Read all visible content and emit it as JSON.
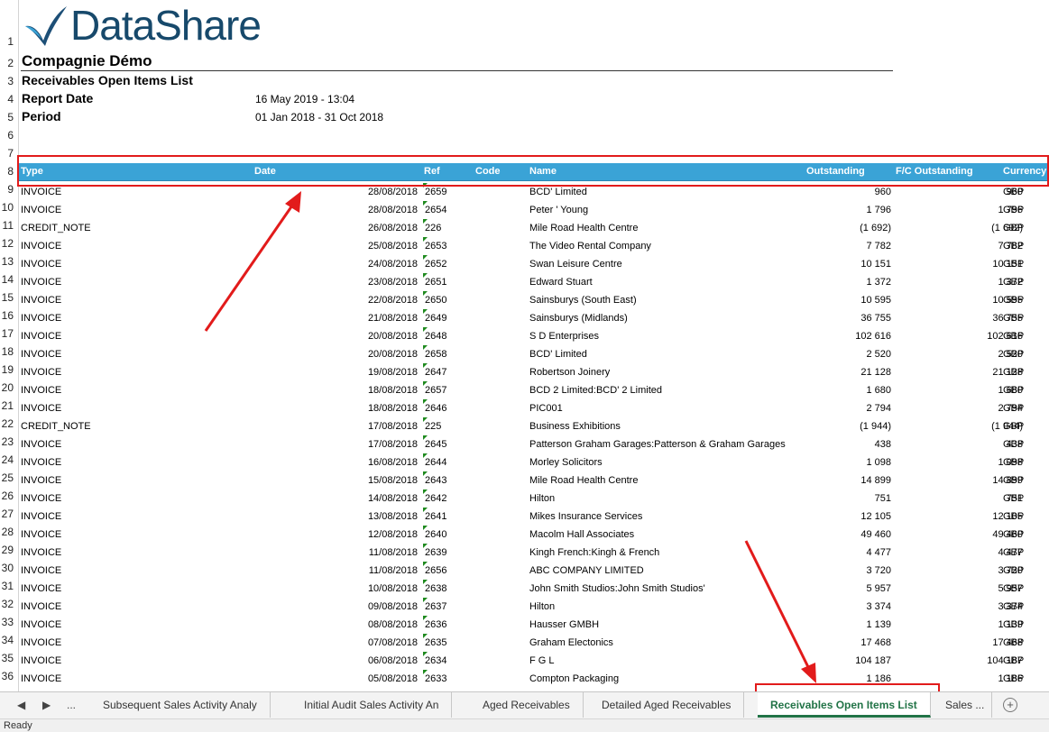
{
  "logo": {
    "text": "DataShare",
    "brand_color": "#17496b"
  },
  "company": "Compagnie Démo",
  "report_title": "Receivables Open Items List",
  "report_date": {
    "label": "Report Date",
    "value": "16 May 2019 - 13:04"
  },
  "period": {
    "label": "Period",
    "value": "01 Jan 2018 - 31 Oct 2018"
  },
  "row_numbers": [
    "1",
    "2",
    "3",
    "4",
    "5",
    "6",
    "7",
    "8",
    "9",
    "10",
    "11",
    "12",
    "13",
    "14",
    "15",
    "16",
    "17",
    "18",
    "19",
    "20",
    "21",
    "22",
    "23",
    "24",
    "25",
    "26",
    "27",
    "28",
    "29",
    "30",
    "31",
    "32",
    "33",
    "34",
    "35",
    "36"
  ],
  "columns": {
    "type": "Type",
    "date": "Date",
    "ref": "Ref",
    "code": "Code",
    "name": "Name",
    "outstanding": "Outstanding",
    "fc_outstanding": "F/C Outstanding",
    "currency": "Currency"
  },
  "rows": [
    {
      "type": "INVOICE",
      "date": "28/08/2018",
      "ref": "2659",
      "name": "BCD' Limited",
      "out": "960",
      "fc": "960",
      "cur": "GBP"
    },
    {
      "type": "INVOICE",
      "date": "28/08/2018",
      "ref": "2654",
      "name": "Peter ' Young",
      "out": "1 796",
      "fc": "1 796",
      "cur": "GBP"
    },
    {
      "type": "CREDIT_NOTE",
      "date": "26/08/2018",
      "ref": "226",
      "name": "Mile Road Health Centre",
      "out": "(1 692)",
      "fc": "(1 692)",
      "cur": "GBP"
    },
    {
      "type": "INVOICE",
      "date": "25/08/2018",
      "ref": "2653",
      "name": "The Video Rental Company",
      "out": "7 782",
      "fc": "7 782",
      "cur": "GBP"
    },
    {
      "type": "INVOICE",
      "date": "24/08/2018",
      "ref": "2652",
      "name": "Swan Leisure Centre",
      "out": "10 151",
      "fc": "10 151",
      "cur": "GBP"
    },
    {
      "type": "INVOICE",
      "date": "23/08/2018",
      "ref": "2651",
      "name": "Edward Stuart",
      "out": "1 372",
      "fc": "1 372",
      "cur": "GBP"
    },
    {
      "type": "INVOICE",
      "date": "22/08/2018",
      "ref": "2650",
      "name": "Sainsburys (South East)",
      "out": "10 595",
      "fc": "10 595",
      "cur": "GBP"
    },
    {
      "type": "INVOICE",
      "date": "21/08/2018",
      "ref": "2649",
      "name": "Sainsburys (Midlands)",
      "out": "36 755",
      "fc": "36 755",
      "cur": "GBP"
    },
    {
      "type": "INVOICE",
      "date": "20/08/2018",
      "ref": "2648",
      "name": "S D Enterprises",
      "out": "102 616",
      "fc": "102 616",
      "cur": "GBP"
    },
    {
      "type": "INVOICE",
      "date": "20/08/2018",
      "ref": "2658",
      "name": "BCD' Limited",
      "out": "2 520",
      "fc": "2 520",
      "cur": "GBP"
    },
    {
      "type": "INVOICE",
      "date": "19/08/2018",
      "ref": "2647",
      "name": "Robertson Joinery",
      "out": "21 128",
      "fc": "21 128",
      "cur": "GBP"
    },
    {
      "type": "INVOICE",
      "date": "18/08/2018",
      "ref": "2657",
      "name": "BCD  2 Limited:BCD' 2 Limited",
      "out": "1 680",
      "fc": "1 680",
      "cur": "GBP"
    },
    {
      "type": "INVOICE",
      "date": "18/08/2018",
      "ref": "2646",
      "name": "PIC001",
      "out": "2 794",
      "fc": "2 794",
      "cur": "GBP"
    },
    {
      "type": "CREDIT_NOTE",
      "date": "17/08/2018",
      "ref": "225",
      "name": "Business Exhibitions",
      "out": "(1 944)",
      "fc": "(1 944)",
      "cur": "GBP"
    },
    {
      "type": "INVOICE",
      "date": "17/08/2018",
      "ref": "2645",
      "name": "Patterson   Graham Garages:Patterson & Graham Garages",
      "out": "438",
      "fc": "438",
      "cur": "GBP"
    },
    {
      "type": "INVOICE",
      "date": "16/08/2018",
      "ref": "2644",
      "name": "Morley Solicitors",
      "out": "1 098",
      "fc": "1 098",
      "cur": "GBP"
    },
    {
      "type": "INVOICE",
      "date": "15/08/2018",
      "ref": "2643",
      "name": "Mile Road Health Centre",
      "out": "14 899",
      "fc": "14 899",
      "cur": "GBP"
    },
    {
      "type": "INVOICE",
      "date": "14/08/2018",
      "ref": "2642",
      "name": "Hilton",
      "out": "751",
      "fc": "751",
      "cur": "GBP"
    },
    {
      "type": "INVOICE",
      "date": "13/08/2018",
      "ref": "2641",
      "name": "Mikes Insurance Services",
      "out": "12 105",
      "fc": "12 105",
      "cur": "GBP"
    },
    {
      "type": "INVOICE",
      "date": "12/08/2018",
      "ref": "2640",
      "name": "Macolm Hall Associates",
      "out": "49 460",
      "fc": "49 460",
      "cur": "GBP"
    },
    {
      "type": "INVOICE",
      "date": "11/08/2018",
      "ref": "2639",
      "name": "Kingh   French:Kingh & French",
      "out": "4 477",
      "fc": "4 477",
      "cur": "GBP"
    },
    {
      "type": "INVOICE",
      "date": "11/08/2018",
      "ref": "2656",
      "name": "ABC COMPANY LIMITED",
      "out": "3 720",
      "fc": "3 720",
      "cur": "GBP"
    },
    {
      "type": "INVOICE",
      "date": "10/08/2018",
      "ref": "2638",
      "name": "John Smith Studios:John Smith Studios'",
      "out": "5 957",
      "fc": "5 957",
      "cur": "GBP"
    },
    {
      "type": "INVOICE",
      "date": "09/08/2018",
      "ref": "2637",
      "name": "Hilton",
      "out": "3 374",
      "fc": "3 374",
      "cur": "GBP"
    },
    {
      "type": "INVOICE",
      "date": "08/08/2018",
      "ref": "2636",
      "name": "Hausser GMBH",
      "out": "1 139",
      "fc": "1 139",
      "cur": "GBP"
    },
    {
      "type": "INVOICE",
      "date": "07/08/2018",
      "ref": "2635",
      "name": "Graham Electonics",
      "out": "17 468",
      "fc": "17 468",
      "cur": "GBP"
    },
    {
      "type": "INVOICE",
      "date": "06/08/2018",
      "ref": "2634",
      "name": "F G L",
      "out": "104 187",
      "fc": "104 187",
      "cur": "GBP"
    },
    {
      "type": "INVOICE",
      "date": "05/08/2018",
      "ref": "2633",
      "name": "Compton Packaging",
      "out": "1 186",
      "fc": "1 186",
      "cur": "GBP"
    }
  ],
  "sheet_tabs": {
    "nav_prev": "◀",
    "nav_next": "▶",
    "nav_more": "...",
    "tabs": [
      {
        "label": "Subsequent Sales Activity Analy",
        "active": false
      },
      {
        "label": "Initial Audit Sales Activity An",
        "active": false
      },
      {
        "label": "Aged Receivables",
        "active": false
      },
      {
        "label": "Detailed Aged Receivables",
        "active": false
      },
      {
        "label": "Receivables Open Items List",
        "active": true
      },
      {
        "label": "Sales ...",
        "active": false
      }
    ],
    "add_label": "+"
  },
  "status": "Ready",
  "colors": {
    "header_band": "#3aa3d6",
    "highlight": "#e21b1b",
    "active_tab": "#217346"
  }
}
